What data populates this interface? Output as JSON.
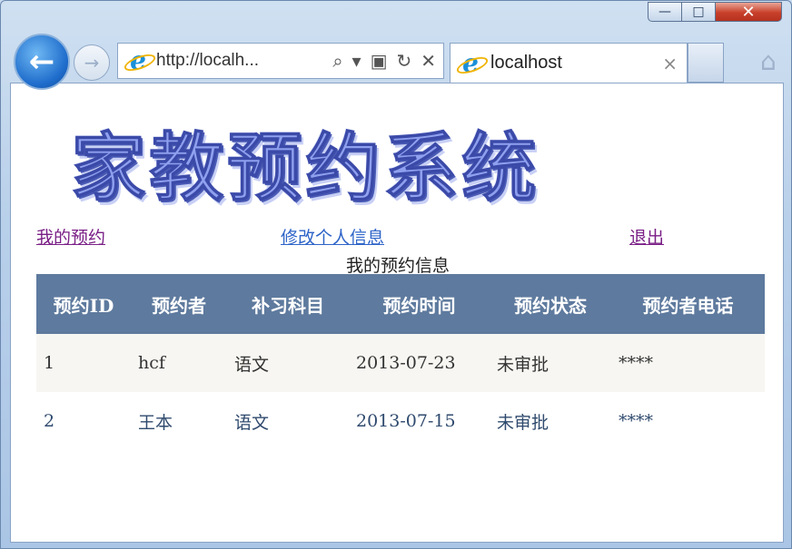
{
  "browser": {
    "address": "http://localh...",
    "tab_title": "localhost",
    "tab_close": "×",
    "window_controls": {
      "minimize": "—",
      "maximize": "□",
      "close": "✕"
    }
  },
  "page": {
    "logo_text": "家教预约系统",
    "nav": {
      "my_bookings": "我的预约",
      "edit_profile": "修改个人信息",
      "logout": "退出"
    },
    "caption": "我的预约信息",
    "table": {
      "headers": [
        "预约ID",
        "预约者",
        "补习科目",
        "预约时间",
        "预约状态",
        "预约者电话"
      ],
      "rows": [
        [
          "1",
          "hcf",
          "语文",
          "2013-07-23",
          "未审批",
          "****"
        ],
        [
          "2",
          "王本",
          "语文",
          "2013-07-15",
          "未审批",
          "****"
        ]
      ]
    }
  },
  "colors": {
    "header_bg": "#5e7a9e",
    "visited_link": "#7a1f86",
    "link": "#2e64c8"
  }
}
